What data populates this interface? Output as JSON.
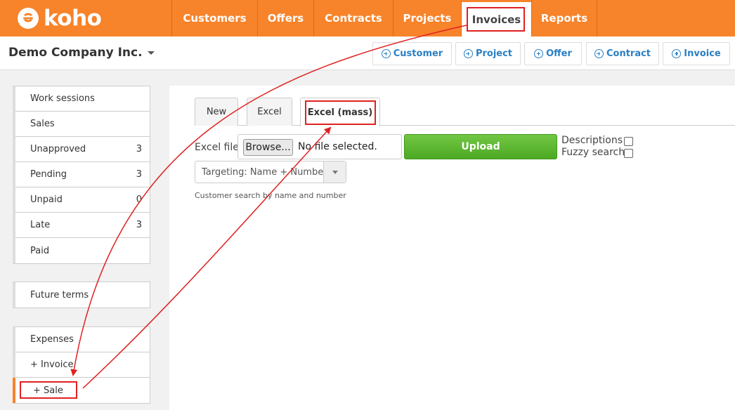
{
  "brand": {
    "logo_text": "koho",
    "accent_color": "#f7832a"
  },
  "nav": {
    "items": [
      {
        "label": "Customers",
        "active": false
      },
      {
        "label": "Offers",
        "active": false
      },
      {
        "label": "Contracts",
        "active": false
      },
      {
        "label": "Projects",
        "active": false
      },
      {
        "label": "Invoices",
        "active": true
      },
      {
        "label": "Reports",
        "active": false
      }
    ]
  },
  "company": {
    "name": "Demo Company Inc."
  },
  "quick_actions": [
    "Customer",
    "Project",
    "Offer",
    "Contract",
    "Invoice"
  ],
  "sidebar": {
    "status_group": [
      {
        "label": "Work sessions",
        "count": ""
      },
      {
        "label": "Sales",
        "count": ""
      },
      {
        "label": "Unapproved",
        "count": "3"
      },
      {
        "label": "Pending",
        "count": "3"
      },
      {
        "label": "Unpaid",
        "count": "0"
      },
      {
        "label": "Late",
        "count": "3"
      },
      {
        "label": "Paid",
        "count": ""
      }
    ],
    "terms_group": [
      {
        "label": "Future terms"
      }
    ],
    "action_group": [
      {
        "label": "Expenses"
      },
      {
        "label": "+ Invoice"
      },
      {
        "label": "+ Sale",
        "active": true
      }
    ]
  },
  "tabs": [
    {
      "label": "New",
      "active": false
    },
    {
      "label": "Excel",
      "active": false
    },
    {
      "label": "Excel (mass)",
      "active": true
    }
  ],
  "upload_form": {
    "file_label": "Excel file",
    "browse_label": "Browse...",
    "file_status": "No file selected.",
    "upload_label": "Upload",
    "descriptions_label": "Descriptions",
    "descriptions_checked": false,
    "fuzzy_label": "Fuzzy search",
    "fuzzy_checked": false,
    "targeting_value": "Targeting: Name + Number",
    "hint": "Customer search by name and number"
  },
  "annotation": {
    "color": "#e02020"
  }
}
